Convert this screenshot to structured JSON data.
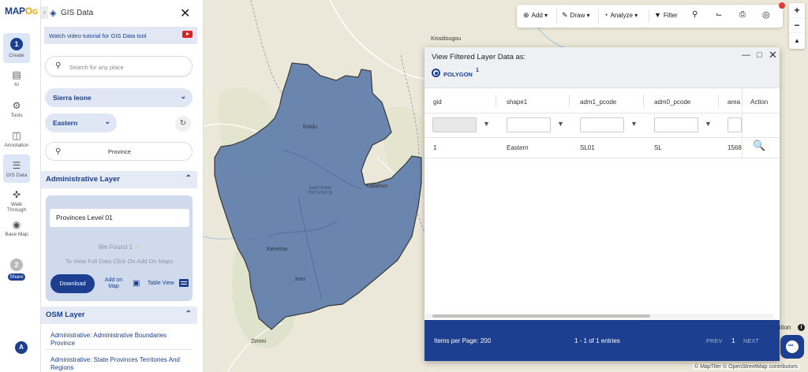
{
  "brand": {
    "logo_prefix": "MAP",
    "logo_suffix": "O"
  },
  "rail": {
    "items": [
      {
        "label": "Create",
        "step": "1"
      },
      {
        "label": "AI"
      },
      {
        "label": "Tools"
      },
      {
        "label": "Annotation"
      },
      {
        "label": "GIS Data"
      },
      {
        "label": "Walk Through"
      },
      {
        "label": "Base Map"
      },
      {
        "label": "Share",
        "step": "2"
      }
    ],
    "avatar": "A"
  },
  "panel": {
    "title": "GIS Data",
    "tutorial": "Watch video tutorial for GIS Data tool",
    "search_placeholder": "Search for any place",
    "country": "Sierra leone",
    "region": "Eastern",
    "province_search": "Province",
    "admin_section": "Administrative Layer",
    "level_value": "Provinces Level 01",
    "found_text": "We Found",
    "found_count": "1",
    "view_full_text": "To View Full Data Click On Add On Maps",
    "download": "Download",
    "add_on_map": "Add on Map",
    "table_view": "Table View",
    "osm_section": "OSM Layer",
    "osm_links": [
      "Administrative: Administrative Boundaries Province",
      "Administrative: State Provinces Territories And Regions"
    ]
  },
  "toolbar": {
    "add": "Add",
    "draw": "Draw",
    "analyze": "Analyze",
    "filter": "Filter"
  },
  "map": {
    "places": [
      "Kissidougou",
      "Koidu",
      "EASTERN PROVINCE",
      "Kailahun",
      "Kenema",
      "Joru",
      "Zimmi",
      "Kerouane"
    ],
    "polygon_color": "#5f7eac",
    "attribution_partial": "ution",
    "copyright": "© MapTiler © OpenStreetMap contributors"
  },
  "data_window": {
    "title": "View Filtered Layer Data as:",
    "geometry_type": "POLYGON",
    "geometry_count": "1",
    "columns": [
      "gid",
      "shape1",
      "adm1_pcode",
      "adm0_pcode",
      "area",
      "Action"
    ],
    "rows": [
      {
        "gid": "1",
        "shape1": "Eastern",
        "adm1_pcode": "SL01",
        "adm0_pcode": "SL",
        "area": "1568"
      }
    ],
    "items_per_page": "Items per Page: 200",
    "range": "1 - 1 of 1 entries",
    "prev": "PREV",
    "page": "1",
    "next": "NEXT"
  },
  "colors": {
    "brand_blue": "#1c3f8f",
    "accent_orange": "#f0a500"
  }
}
